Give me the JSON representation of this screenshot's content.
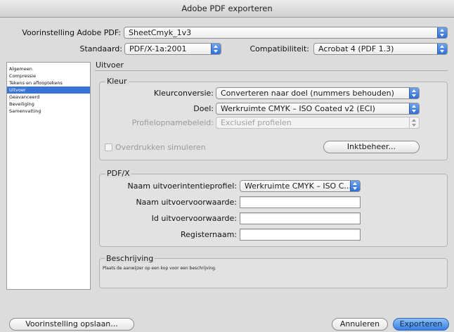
{
  "window": {
    "title": "Adobe PDF exporteren"
  },
  "preset": {
    "label": "Voorinstelling Adobe PDF:",
    "value": "SheetCmyk_1v3"
  },
  "standard": {
    "label": "Standaard:",
    "value": "PDF/X-1a:2001"
  },
  "compat": {
    "label": "Compatibiliteit:",
    "value": "Acrobat 4 (PDF 1.3)"
  },
  "sidebar": {
    "items": [
      {
        "label": "Algemeen"
      },
      {
        "label": "Compressie"
      },
      {
        "label": "Tekens en aflooptekens"
      },
      {
        "label": "Uitvoer"
      },
      {
        "label": "Geavanceerd"
      },
      {
        "label": "Beveiliging"
      },
      {
        "label": "Samenvatting"
      }
    ],
    "selected": "Uitvoer"
  },
  "section": {
    "title": "Uitvoer"
  },
  "kleur": {
    "title": "Kleur",
    "conversion_label": "Kleurconversie:",
    "conversion_value": "Converteren naar doel (nummers behouden)",
    "target_label": "Doel:",
    "target_value": "Werkruimte CMYK – ISO Coated v2 (ECI)",
    "profile_policy_label": "Profielopnamebeleid:",
    "profile_policy_value": "Exclusief profielen",
    "overprint_label": "Overdrukken simuleren",
    "ink_button": "Inktbeheer..."
  },
  "pdfx": {
    "title": "PDF/X",
    "output_intent_label": "Naam uitvoerintentieprofiel:",
    "output_intent_value": "Werkruimte CMYK – ISO C...",
    "condition_name_label": "Naam uitvoervoorwaarde:",
    "condition_name_value": "",
    "condition_id_label": "Id uitvoervoorwaarde:",
    "condition_id_value": "",
    "registry_label": "Registernaam:",
    "registry_value": ""
  },
  "description": {
    "title": "Beschrijving",
    "text": "Plaats de aanwijzer op een kop voor een beschrijving."
  },
  "footer": {
    "save_preset": "Voorinstelling opslaan...",
    "cancel": "Annuleren",
    "export": "Exporteren"
  }
}
